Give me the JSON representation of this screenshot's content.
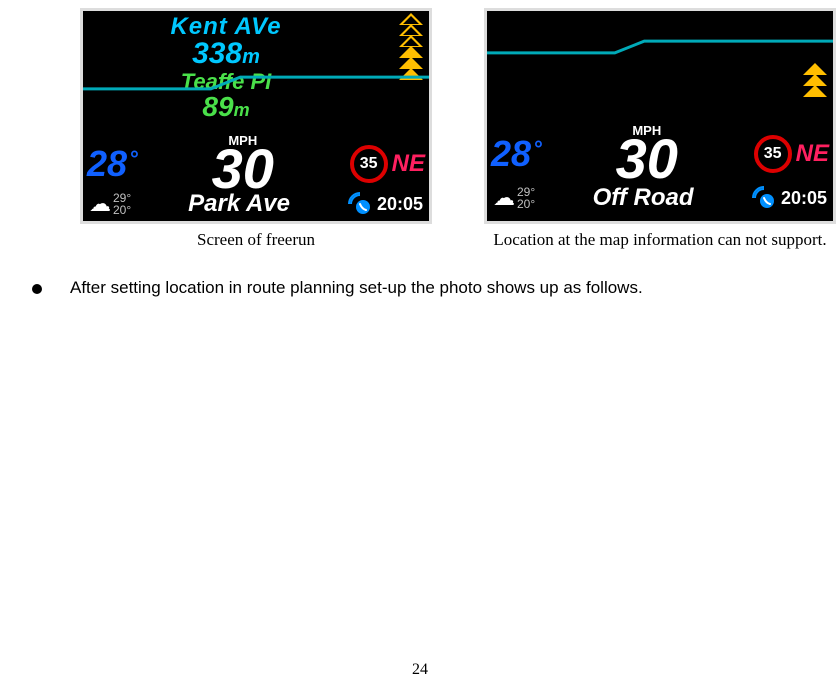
{
  "screenshot_left": {
    "nav_street1": "Kent AVe",
    "nav_dist1_val": "338",
    "nav_dist1_unit": "m",
    "nav_street2": "Teaffe PI",
    "nav_dist2_val": "89",
    "nav_dist2_unit": "m",
    "temperature": "28",
    "speed_label": "MPH",
    "speed_value": "30",
    "speed_limit": "35",
    "compass": "NE",
    "hi_temp": "29°",
    "lo_temp": "20°",
    "current_street": "Park Ave",
    "call_time": "20:05",
    "caption": "Screen of freerun"
  },
  "screenshot_right": {
    "temperature": "28",
    "speed_label": "MPH",
    "speed_value": "30",
    "speed_limit": "35",
    "compass": "NE",
    "hi_temp": "29°",
    "lo_temp": "20°",
    "current_street": "Off Road",
    "call_time": "20:05",
    "caption": "Location at the map information can not support."
  },
  "bullet_text": "After setting location in route planning set-up the photo shows up as follows.",
  "page_number": "24"
}
